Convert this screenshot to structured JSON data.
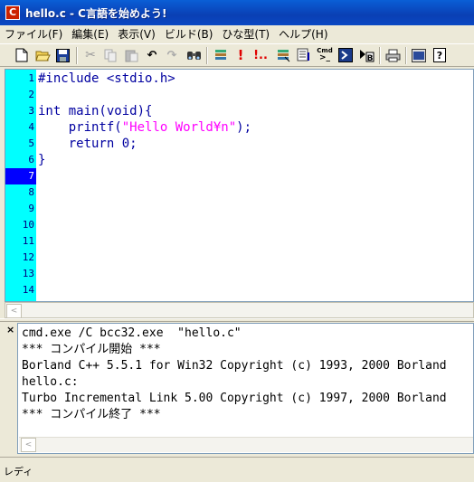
{
  "window": {
    "title": "hello.c - C言語を始めよう!",
    "app_icon": "C"
  },
  "menu": [
    "ファイル(F)",
    "編集(E)",
    "表示(V)",
    "ビルド(B)",
    "ひな型(T)",
    "ヘルプ(H)"
  ],
  "toolbar": {
    "icons": [
      "new-file-icon",
      "open-folder-icon",
      "save-icon",
      "cut-icon",
      "copy-icon",
      "paste-icon",
      "undo-icon",
      "redo-icon",
      "find-icon",
      "compile-icon",
      "build-icon",
      "run-icon",
      "options-icon",
      "list-icon",
      "cmd-icon",
      "run-prompt-icon",
      "build-b-icon",
      "print-icon",
      "console-icon",
      "help-icon"
    ],
    "cmd_label": "Cmd"
  },
  "editor": {
    "line_numbers": [
      "1",
      "2",
      "3",
      "4",
      "5",
      "6",
      "7",
      "8",
      "9",
      "10",
      "11",
      "12",
      "13",
      "14"
    ],
    "current_line": "7",
    "lines": [
      "#include <stdio.h>",
      "",
      "int main(void){",
      "    printf(",
      "    return 0;",
      "}"
    ],
    "printf_string": "\"Hello World¥n\"",
    "printf_tail": ");"
  },
  "output": {
    "lines": [
      "cmd.exe /C bcc32.exe  \"hello.c\"",
      "*** コンパイル開始 ***",
      "Borland C++ 5.5.1 for Win32 Copyright (c) 1993, 2000 Borland",
      "hello.c:",
      "Turbo Incremental Link 5.00 Copyright (c) 1997, 2000 Borland",
      "*** コンパイル終了 ***"
    ]
  },
  "status": {
    "text": "レディ"
  },
  "colors": {
    "title_bar": "#0a4fc8",
    "gutter": "#00ffff",
    "current_line": "#0000ff",
    "code_text": "#0000a0",
    "string": "#ff00ff"
  }
}
